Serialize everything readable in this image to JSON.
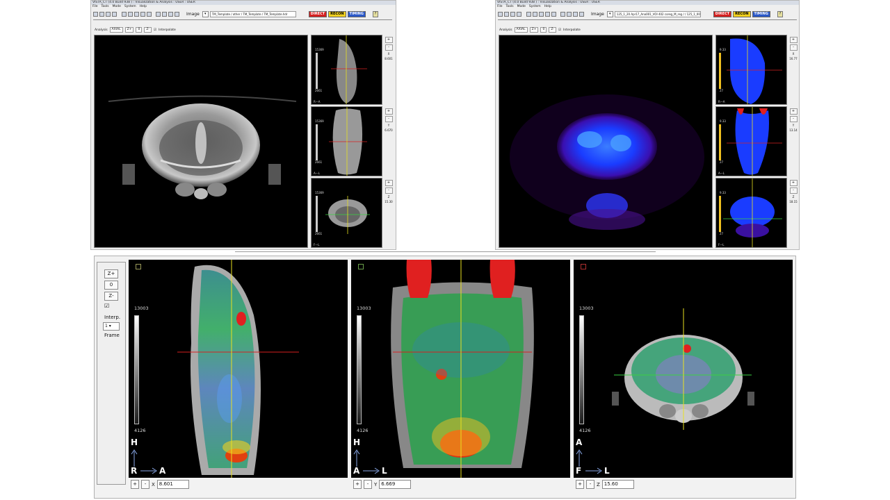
{
  "left_window": {
    "title": "VISTA_CT (4.0 Build 938 ) : Visualization & Analysis : USER : USER",
    "menu": [
      "File",
      "Tools",
      "Mode",
      "System",
      "Help"
    ],
    "image_label": "Image",
    "image_path": "TM_Template / other / TM_Template / TM_Template.hdr",
    "mode_buttons": [
      "DIRECT",
      "RECON",
      "TIMING"
    ],
    "analysis_label": "Analysis",
    "analysis_value": "AXIAL",
    "zoom_buttons": [
      "Z+",
      "0",
      "Z-"
    ],
    "interpolate_label": "Interpolate",
    "thumbs": [
      {
        "max": "15369",
        "min": "2661",
        "orient": "R—A",
        "coord_label": "X",
        "coord": "8.601"
      },
      {
        "max": "15369",
        "min": "2661",
        "orient": "A—L",
        "coord_label": "Y",
        "coord": "6.670"
      },
      {
        "max": "15369",
        "min": "2661",
        "orient": "F—L",
        "coord_label": "Z",
        "coord": "15.30"
      }
    ]
  },
  "right_window": {
    "title": "VISTA_CT (4.0 Build 938 ) : Visualization & Analysis : USER : USER",
    "menu": [
      "File",
      "Tools",
      "Mode",
      "System",
      "Help"
    ],
    "image_label": "Image",
    "image_path": "125_1_20 Apr17_Ana001_VOI 402 coreg_M_reg / / 125_1_001b",
    "mode_buttons": [
      "DIRECT",
      "RECON",
      "TIMING"
    ],
    "analysis_label": "Analysis",
    "analysis_value": "AXIAL",
    "zoom_buttons": [
      "Z+",
      "0",
      "Z-"
    ],
    "interpolate_label": "Interpolate",
    "thumbs": [
      {
        "max": "9.33",
        "min": "27",
        "orient": "R—A",
        "coord_label": "X",
        "coord": "16.77"
      },
      {
        "max": "9.33",
        "min": "27",
        "orient": "A—L",
        "coord_label": "Y",
        "coord": "13.14"
      },
      {
        "max": "9.33",
        "min": "27",
        "orient": "F—L",
        "coord_label": "Z",
        "coord": "18.15"
      }
    ]
  },
  "bottom": {
    "zoom_in": "Z+",
    "zoom_reset": "0",
    "zoom_out": "Z-",
    "interp_label": "Interp.",
    "interp_value": "1",
    "frame_label": "Frame",
    "views": [
      {
        "scale_max": "13003",
        "scale_min": "4126",
        "orient_v": "H",
        "orient_h1": "R",
        "orient_h2": "A",
        "coord_label": "X",
        "coord": "8.601",
        "corner_color": "#9a9a5a"
      },
      {
        "scale_max": "13003",
        "scale_min": "4126",
        "orient_v": "H",
        "orient_h1": "A",
        "orient_h2": "L",
        "coord_label": "Y",
        "coord": "6.669",
        "corner_color": "#6aa04a"
      },
      {
        "scale_max": "13003",
        "scale_min": "4126",
        "orient_v": "A",
        "orient_h1": "F",
        "orient_h2": "L",
        "coord_label": "Z",
        "coord": "15.60",
        "corner_color": "#b03030"
      }
    ]
  },
  "colors": {
    "direct": "#d42020",
    "recon": "#f0d020",
    "timing": "#2a58c8",
    "crosshair_h": "#d62020",
    "crosshair_v": "#e8e020",
    "crosshair_green": "#3ad040"
  }
}
